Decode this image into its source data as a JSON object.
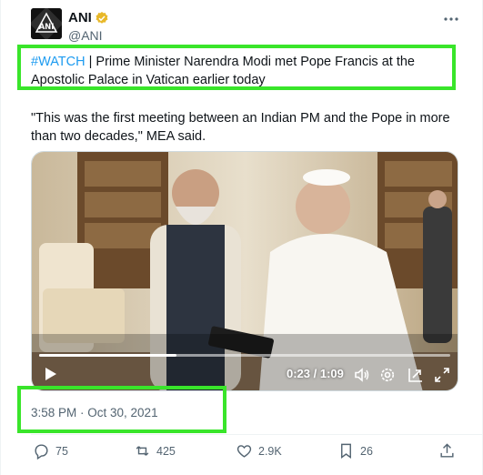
{
  "author": {
    "name": "ANI",
    "handle": "@ANI",
    "avatar_text": "ANI",
    "verified": "gold-verified-badge-icon"
  },
  "menu": {
    "more_icon": "more-options-icon"
  },
  "tweet": {
    "hashtag": "#WATCH",
    "text_after_hashtag": " | Prime Minister Narendra Modi met Pope Francis at the Apostolic Palace in Vatican earlier today",
    "quote": "\"This was the first meeting between an Indian PM and the Pope in more than two decades,\" MEA said."
  },
  "video": {
    "time_display": "0:23 / 1:09",
    "progress_fraction": 0.333,
    "icons": [
      "play-icon",
      "volume-icon",
      "settings-icon",
      "picture-in-picture-icon",
      "fullscreen-icon"
    ]
  },
  "timestamp": "3:58 PM · Oct 30, 2021",
  "stats": {
    "replies": "75",
    "reposts": "425",
    "likes": "2.9K",
    "bookmarks": "26"
  },
  "colors": {
    "link": "#1d9bf0",
    "highlight": "#39e52a",
    "muted": "#536471",
    "verified_gold": "#e8b829"
  }
}
